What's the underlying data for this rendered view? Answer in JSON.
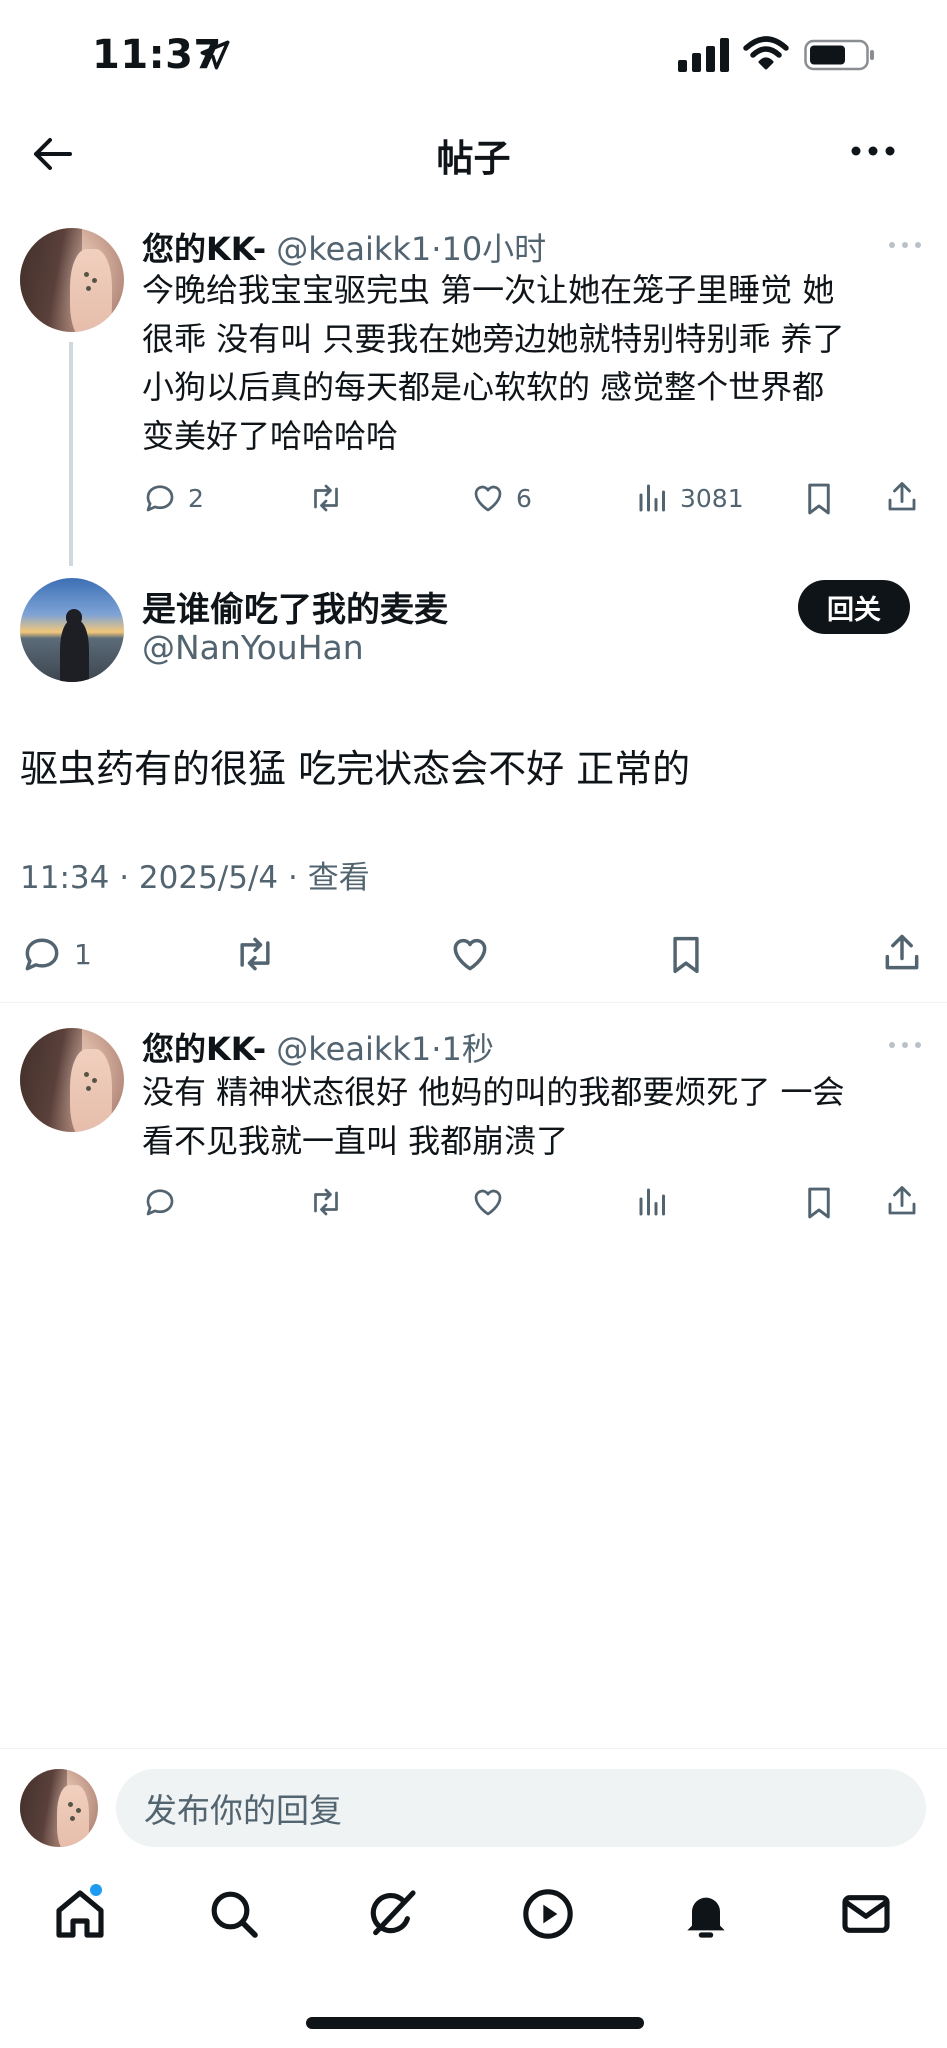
{
  "status_bar": {
    "time": "11:37"
  },
  "nav": {
    "title": "帖子"
  },
  "parent_tweet": {
    "name": "您的KK-",
    "handle": "@keaikk1",
    "time": "10小时",
    "lines": [
      "今晚给我宝宝驱完虫 第一次让她在笼子里睡觉 她",
      "很乖 没有叫 只要我在她旁边她就特别特别乖 养了",
      "小狗以后真的每天都是心软软的  感觉整个世界都",
      "变美好了哈哈哈哈"
    ],
    "replies": "2",
    "views": "3081"
  },
  "focus_tweet": {
    "name": "是谁偷吃了我的麦麦",
    "handle": "@NanYouHan",
    "follow_label": "回关",
    "text": "驱虫药有的很猛 吃完状态会不好 正常的",
    "meta": "11:34 · 2025/5/4 · 查看",
    "replies": "1"
  },
  "reply_tweet": {
    "name": "您的KK-",
    "handle": "@keaikk1",
    "time": "1秒",
    "lines": [
      "没有 精神状态很好 他妈的叫的我都要烦死了 一会",
      "看不见我就一直叫 我都崩溃了"
    ]
  },
  "reply_bar": {
    "placeholder": "发布你的回复"
  },
  "tabs": [
    "home-icon",
    "search-icon",
    "grok-icon",
    "video-icon",
    "bell-icon",
    "mail-icon"
  ],
  "colors": {
    "text": "#0f1419",
    "secondary": "#536471",
    "accent": "#1d9bf0",
    "divider": "#eff3f4"
  }
}
